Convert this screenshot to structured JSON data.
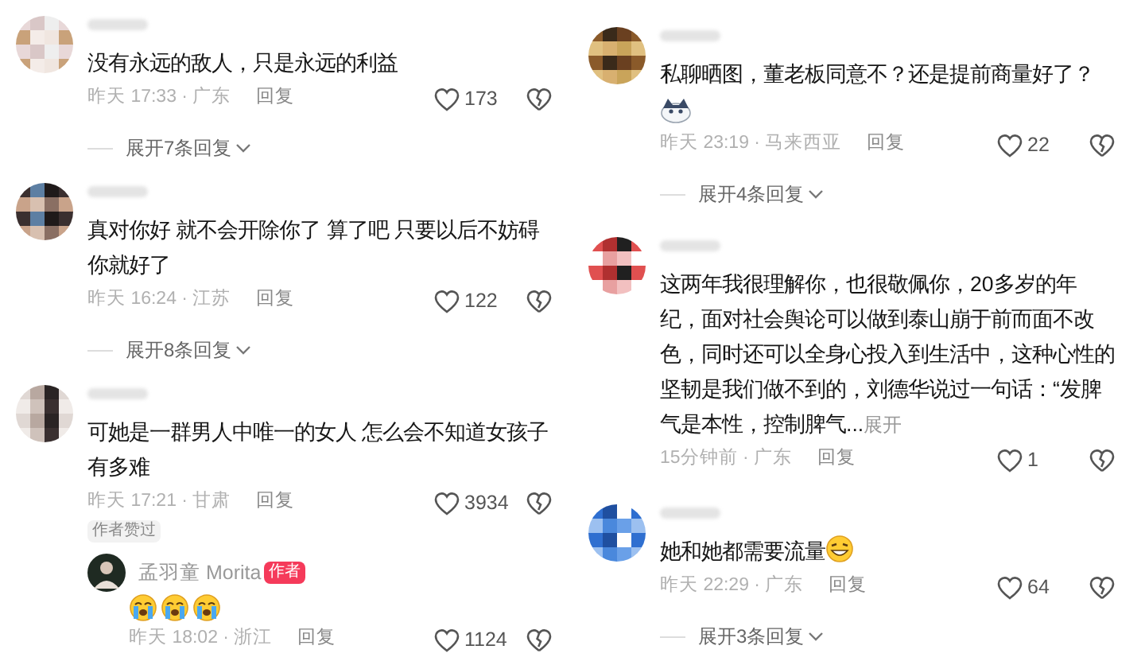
{
  "columns": [
    {
      "comments": [
        {
          "text": "没有永远的敌人，只是永远的利益",
          "time_location": "昨天 17:33 · 广东",
          "reply_label": "回复",
          "likes": "173",
          "replies_toggle": "展开7条回复"
        },
        {
          "text": "真对你好 就不会开除你了 算了吧 只要以后不妨碍你就好了",
          "time_location": "昨天 16:24 · 江苏",
          "reply_label": "回复",
          "likes": "122",
          "replies_toggle": "展开8条回复"
        },
        {
          "text": "可她是一群男人中唯一的女人 怎么会不知道女孩子有多难",
          "time_location": "昨天 17:21 · 甘肃",
          "reply_label": "回复",
          "likes": "3934",
          "author_liked": "作者赞过",
          "replies": [
            {
              "author": "孟羽童 Morita",
              "author_badge": "作者",
              "emojis": [
                {
                  "kind": "crying"
                },
                {
                  "kind": "crying"
                },
                {
                  "kind": "crying"
                }
              ],
              "time_location": "昨天 18:02 · 浙江",
              "reply_label": "回复",
              "likes": "1124"
            }
          ]
        }
      ]
    },
    {
      "comments": [
        {
          "text": "私聊晒图，董老板同意不？还是提前商量好了？",
          "sticker": {
            "kind": "cat"
          },
          "time_location": "昨天 23:19 · 马来西亚",
          "reply_label": "回复",
          "likes": "22",
          "replies_toggle": "展开4条回复"
        },
        {
          "text": "这两年我很理解你，也很敬佩你，20多岁的年纪，面对社会舆论可以做到泰山崩于前而面不改色，同时还可以全身心投入到生活中，这种心性的坚韧是我们做不到的，刘德华说过一句话：“发脾气是本性，控制脾气...",
          "expand_link": "展开",
          "time_location": "15分钟前 · 广东",
          "reply_label": "回复",
          "likes": "1"
        },
        {
          "text": "她和她都需要流量",
          "emojis": [
            {
              "kind": "grinning"
            }
          ],
          "time_location": "昨天 22:29 · 广东",
          "reply_label": "回复",
          "likes": "64",
          "replies_toggle": "展开3条回复"
        }
      ]
    }
  ]
}
